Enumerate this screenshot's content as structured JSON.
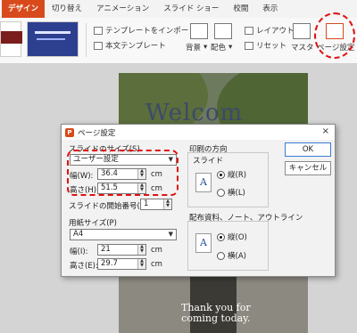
{
  "ribbon": {
    "tabs": [
      "デザイン",
      "切り替え",
      "アニメーション",
      "スライド ショー",
      "校閲",
      "表示"
    ],
    "import_template": "テンプレートをインポート",
    "body_template": "本文テンプレート",
    "background": "背景",
    "colors": "配色",
    "layout": "レイアウト",
    "reset": "リセット",
    "master": "マスタ",
    "page_setup": "ページ設定",
    "accent_color": "#d84a1b"
  },
  "slide": {
    "welcome": "Welcom",
    "thanks_line1": "Thank you for",
    "thanks_line2": "coming today."
  },
  "dialog": {
    "title": "ページ設定",
    "close": "×",
    "slide_size_label": "スライドのサイズ(S)",
    "slide_size_value": "ユーザー設定",
    "width_label": "幅(W):",
    "width_value": "36.4",
    "height_label": "高さ(H):",
    "height_value": "51.5",
    "unit": "cm",
    "start_number_label": "スライドの開始番号(N):",
    "start_number_value": "1",
    "paper_size_label": "用紙サイズ(P)",
    "paper_size_value": "A4",
    "paper_width_label": "幅(I):",
    "paper_width_value": "21",
    "paper_height_label": "高さ(E):",
    "paper_height_value": "29.7",
    "orientation_label": "印刷の方向",
    "slide_label": "スライド",
    "portrait_r": "縦(R)",
    "landscape_l": "横(L)",
    "notes_label": "配布資料、ノート、アウトライン",
    "portrait_o": "縦(O)",
    "landscape_a": "横(A)",
    "ok": "OK",
    "cancel": "キャンセル"
  }
}
